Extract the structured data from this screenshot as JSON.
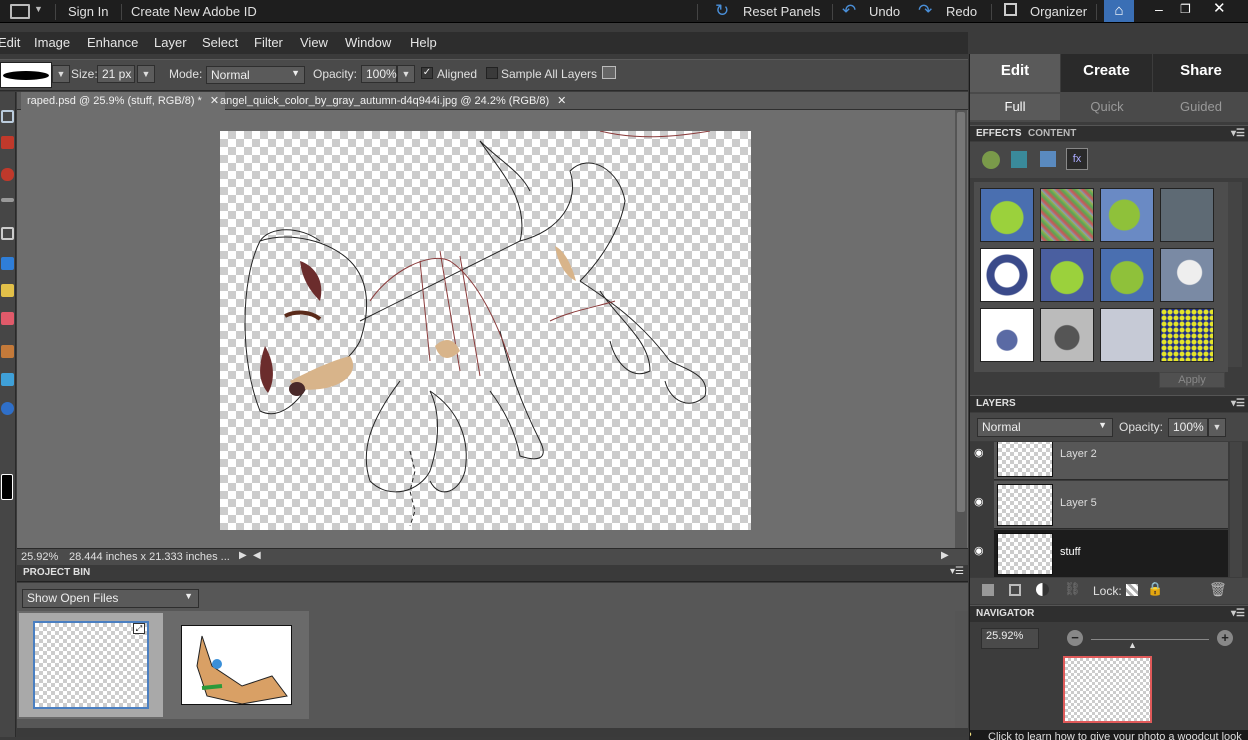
{
  "titlebar": {
    "sign_in": "Sign In",
    "create_id": "Create New Adobe ID",
    "reset_panels": "Reset Panels",
    "undo": "Undo",
    "redo": "Redo",
    "organizer": "Organizer"
  },
  "menu": [
    "Edit",
    "Image",
    "Enhance",
    "Layer",
    "Select",
    "Filter",
    "View",
    "Window",
    "Help"
  ],
  "options": {
    "size_label": "Size:",
    "size_value": "21 px",
    "mode_label": "Mode:",
    "mode_value": "Normal",
    "opacity_label": "Opacity:",
    "opacity_value": "100%",
    "aligned_label": "Aligned",
    "aligned_checked": true,
    "sample_all_label": "Sample All Layers",
    "sample_all_checked": false
  },
  "tabs": [
    {
      "label": "raped.psd @ 25.9% (stuff, RGB/8) *",
      "active": true
    },
    {
      "label": "angel_quick_color_by_gray_autumn-d4q944i.jpg @ 24.2% (RGB/8)",
      "active": false
    }
  ],
  "status": {
    "zoom": "25.92%",
    "doc_size": "28.444 inches x 21.333 inches ..."
  },
  "project_bin": {
    "title": "PROJECT BIN",
    "show_label": "Show Open Files"
  },
  "right": {
    "main_tabs": [
      "Edit",
      "Create",
      "Share"
    ],
    "active_main_tab": "Edit",
    "sub_tabs": [
      "Full",
      "Quick",
      "Guided"
    ],
    "active_sub_tab": "Full",
    "effects_tab": "EFFECTS",
    "content_tab": "CONTENT",
    "apply": "Apply",
    "layers_title": "LAYERS",
    "blend_mode": "Normal",
    "opacity_label": "Opacity:",
    "opacity_value": "100%",
    "layers": [
      "Layer 2",
      "Layer 5",
      "stuff"
    ],
    "selected_layer": "stuff",
    "lock_label": "Lock:",
    "navigator_title": "NAVIGATOR",
    "nav_zoom": "25.92%"
  },
  "footer_hint": "Click to learn how to give your photo a woodcut look",
  "colors": {
    "accent_blue": "#4a7fc1",
    "panel_bg": "#3c3c3c",
    "nav_frame": "#e05a5a"
  }
}
